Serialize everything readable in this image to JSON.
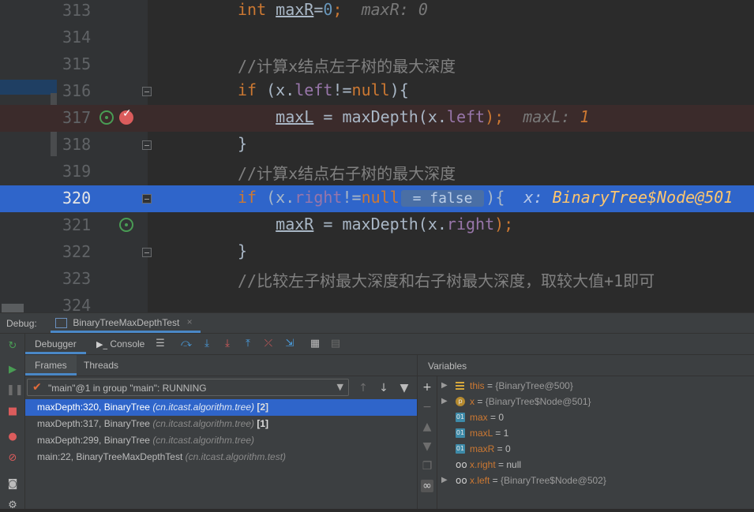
{
  "editor": {
    "lines": [
      {
        "num": "313",
        "kind": "normal",
        "parts": [
          {
            "t": "int",
            "c": "kw"
          },
          {
            "t": " "
          },
          {
            "t": "maxR",
            "c": "ul"
          },
          {
            "t": "=",
            "c": "x"
          },
          {
            "t": "0",
            "c": "num"
          },
          {
            "t": ";",
            "c": "kw"
          },
          {
            "t": "  maxR: 0",
            "c": "inl"
          }
        ]
      },
      {
        "num": "314",
        "kind": "normal",
        "parts": []
      },
      {
        "num": "315",
        "kind": "normal",
        "parts": [
          {
            "t": "//计算x结点左子树的最大深度",
            "c": "cmt"
          }
        ]
      },
      {
        "num": "316",
        "kind": "normal",
        "fold": true,
        "parts": [
          {
            "t": "if",
            "c": "kw"
          },
          {
            "t": " (x."
          },
          {
            "t": "left",
            "c": "fld"
          },
          {
            "t": "!="
          },
          {
            "t": "null",
            "c": "kw"
          },
          {
            "t": "){"
          }
        ]
      },
      {
        "num": "317",
        "kind": "bp",
        "parts": [
          {
            "t": "    "
          },
          {
            "t": "maxL",
            "c": "ul"
          },
          {
            "t": " = maxDepth(x."
          },
          {
            "t": "left",
            "c": "fld"
          },
          {
            "t": ");",
            "c": "kw"
          },
          {
            "t": "  maxL: ",
            "c": "inl"
          },
          {
            "t": "1",
            "c": "inl-val"
          }
        ]
      },
      {
        "num": "318",
        "kind": "normal",
        "fold": true,
        "parts": [
          {
            "t": "}"
          }
        ]
      },
      {
        "num": "319",
        "kind": "normal",
        "parts": [
          {
            "t": "//计算x结点右子树的最大深度",
            "c": "cmt"
          }
        ]
      },
      {
        "num": "320",
        "kind": "cur",
        "fold": true,
        "parts": [
          {
            "t": "if",
            "c": "kw"
          },
          {
            "t": " (x."
          },
          {
            "t": "right",
            "c": "fld"
          },
          {
            "t": "!="
          },
          {
            "t": "null",
            "c": "kw"
          },
          {
            "t": " = false ",
            "c": "pill"
          },
          {
            "t": "){"
          },
          {
            "t": "  x: ",
            "c": "inl"
          },
          {
            "t": "BinaryTree$Node@501",
            "c": "inl-val"
          }
        ]
      },
      {
        "num": "321",
        "kind": "normal",
        "parts": [
          {
            "t": "    "
          },
          {
            "t": "maxR",
            "c": "ul"
          },
          {
            "t": " = maxDepth(x."
          },
          {
            "t": "right",
            "c": "fld"
          },
          {
            "t": ");",
            "c": "kw"
          }
        ]
      },
      {
        "num": "322",
        "kind": "normal",
        "fold": true,
        "parts": [
          {
            "t": "}"
          }
        ]
      },
      {
        "num": "323",
        "kind": "normal",
        "parts": [
          {
            "t": "//比较左子树最大深度和右子树最大深度，取较大值+1即可",
            "c": "cmt"
          }
        ]
      },
      {
        "num": "324",
        "kind": "normal",
        "parts": []
      }
    ]
  },
  "debug": {
    "label": "Debug:",
    "session_tab": "BinaryTreeMaxDepthTest",
    "close_glyph": "×",
    "tabs": {
      "debugger": "Debugger",
      "console": "Console"
    },
    "frames_tabs": {
      "frames": "Frames",
      "threads": "Threads"
    },
    "thread_select": "\"main\"@1 in group \"main\": RUNNING",
    "frames": [
      {
        "method": "maxDepth:320, BinaryTree",
        "pkg": "(cn.itcast.algorithm.tree)",
        "idx": "[2]",
        "selected": true
      },
      {
        "method": "maxDepth:317, BinaryTree",
        "pkg": "(cn.itcast.algorithm.tree)",
        "idx": "[1]",
        "selected": false
      },
      {
        "method": "maxDepth:299, BinaryTree",
        "pkg": "(cn.itcast.algorithm.tree)",
        "idx": "",
        "selected": false
      },
      {
        "method": "main:22, BinaryTreeMaxDepthTest",
        "pkg": "(cn.itcast.algorithm.test)",
        "idx": "",
        "selected": false
      }
    ],
    "variables_title": "Variables",
    "variables": [
      {
        "expand": "▶",
        "icon": "lines",
        "name": "this",
        "value": "{BinaryTree@500}",
        "kind": "obj"
      },
      {
        "expand": "▶",
        "icon": "param",
        "icon_text": "p",
        "name": "x",
        "value": "{BinaryTree$Node@501}",
        "kind": "obj"
      },
      {
        "expand": "",
        "icon": "prim",
        "icon_text": "01",
        "name": "max",
        "value": "0",
        "kind": "prim"
      },
      {
        "expand": "",
        "icon": "prim",
        "icon_text": "01",
        "name": "maxL",
        "value": "1",
        "kind": "prim"
      },
      {
        "expand": "",
        "icon": "prim",
        "icon_text": "01",
        "name": "maxR",
        "value": "0",
        "kind": "prim"
      },
      {
        "expand": "",
        "icon": "watch",
        "icon_text": "oo",
        "name": "x.right",
        "value": "null",
        "kind": "watch"
      },
      {
        "expand": "▶",
        "icon": "watch",
        "icon_text": "oo",
        "name": "x.left",
        "value": "{BinaryTree$Node@502}",
        "kind": "watch"
      }
    ]
  },
  "colors": {
    "accent": "#2f65ca",
    "keyword": "#cc7832",
    "comment": "#808080",
    "field": "#9876aa"
  }
}
